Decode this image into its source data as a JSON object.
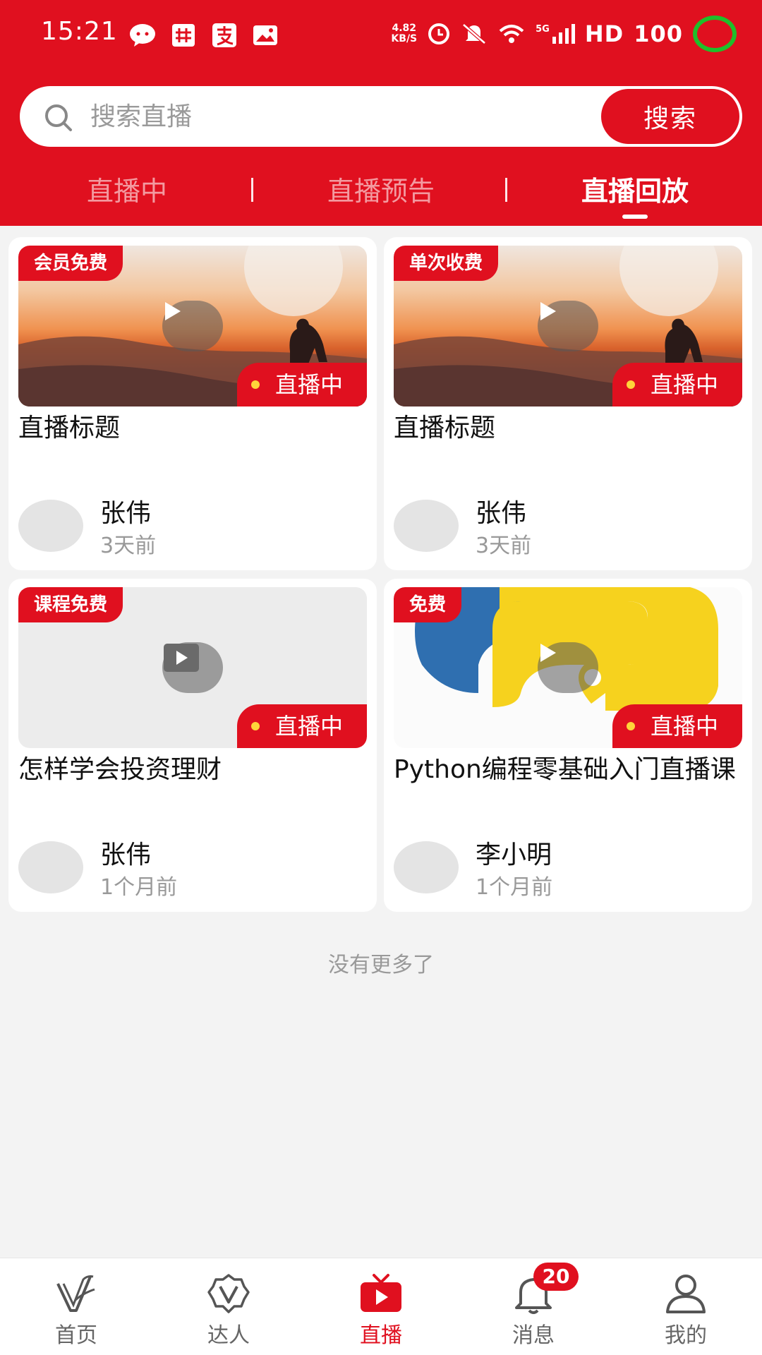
{
  "status_bar": {
    "time": "15:21",
    "app_icons": [
      "wechat-icon",
      "grid-app-icon",
      "alipay-icon",
      "photo-app-icon"
    ],
    "net_speed_value": "4.82",
    "net_speed_unit": "KB/S",
    "network": "5G",
    "hd": "HD",
    "battery": "100"
  },
  "search": {
    "placeholder": "搜索直播",
    "button_label": "搜索"
  },
  "tabs": [
    {
      "label": "直播中",
      "active": false
    },
    {
      "label": "直播预告",
      "active": false
    },
    {
      "label": "直播回放",
      "active": true
    }
  ],
  "cards": [
    {
      "badge": "会员免费",
      "live_label": "直播中",
      "title": "直播标题",
      "author": "张伟",
      "time": "3天前",
      "thumb": "sunset"
    },
    {
      "badge": "单次收费",
      "live_label": "直播中",
      "title": "直播标题",
      "author": "张伟",
      "time": "3天前",
      "thumb": "sunset"
    },
    {
      "badge": "课程免费",
      "live_label": "直播中",
      "title": "怎样学会投资理财",
      "author": "张伟",
      "time": "1个月前",
      "thumb": "blank"
    },
    {
      "badge": "免费",
      "live_label": "直播中",
      "title": "Python编程零基础入门直播课",
      "author": "李小明",
      "time": "1个月前",
      "thumb": "python"
    }
  ],
  "list_footer": "没有更多了",
  "bottom_nav": [
    {
      "label": "首页",
      "icon": "home-logo-icon",
      "active": false
    },
    {
      "label": "达人",
      "icon": "expert-v-icon",
      "active": false
    },
    {
      "label": "直播",
      "icon": "live-tv-icon",
      "active": true
    },
    {
      "label": "消息",
      "icon": "bell-icon",
      "active": false,
      "badge": "20"
    },
    {
      "label": "我的",
      "icon": "user-icon",
      "active": false
    }
  ],
  "colors": {
    "brand_red": "#e0101f",
    "live_dot": "#ffd43a",
    "tab_inactive": "#f39aa0"
  }
}
